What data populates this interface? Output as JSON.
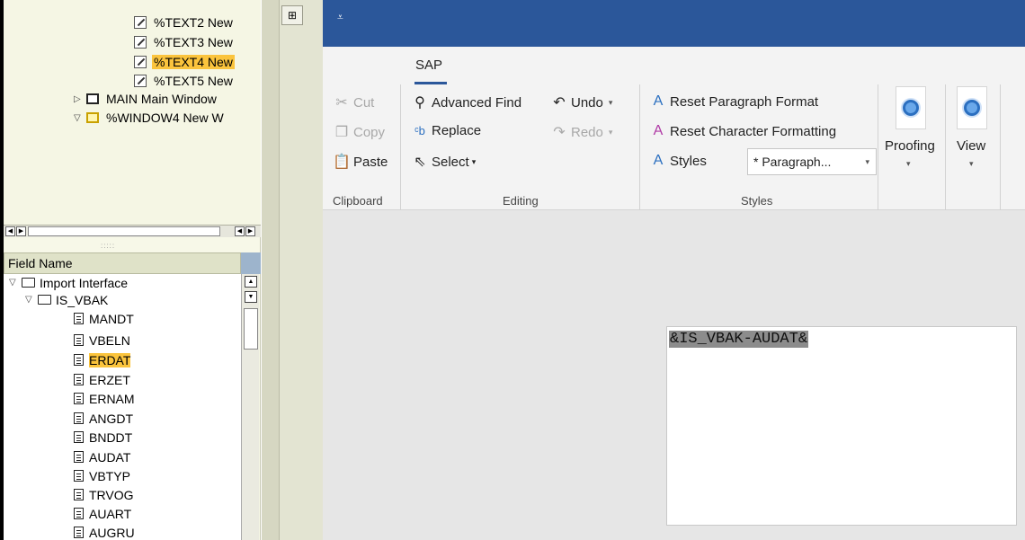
{
  "sap_tree": {
    "nodes": [
      "%TEXT2 New",
      "%TEXT3 New",
      "%TEXT4 New",
      "%TEXT5 New",
      "MAIN Main Window",
      "%WINDOW4 New W"
    ]
  },
  "field_list": {
    "header": "Field Name",
    "root": "Import Interface",
    "group": "IS_VBAK",
    "items": [
      "MANDT",
      "VBELN",
      "ERDAT",
      "ERZET",
      "ERNAM",
      "ANGDT",
      "BNDDT",
      "AUDAT",
      "VBTYP",
      "TRVOG",
      "AUART",
      "AUGRU"
    ]
  },
  "ribbon": {
    "tab": "SAP",
    "clipboard": {
      "cut": "Cut",
      "copy": "Copy",
      "paste": "Paste",
      "label": "Clipboard"
    },
    "editing": {
      "advanced_find": "Advanced Find",
      "replace": "Replace",
      "select": "Select",
      "undo": "Undo",
      "redo": "Redo",
      "label": "Editing"
    },
    "styles": {
      "reset_paragraph": "Reset Paragraph Format",
      "reset_character": "Reset Character Formatting",
      "styles": "Styles",
      "style_value": "* Paragraph...",
      "label": "Styles"
    },
    "proofing": "Proofing",
    "view": "View"
  },
  "document": {
    "text": "&IS_VBAK-AUDAT&"
  },
  "colors": {
    "title_bar": "#2b579a",
    "selection": "#fbc43d"
  }
}
